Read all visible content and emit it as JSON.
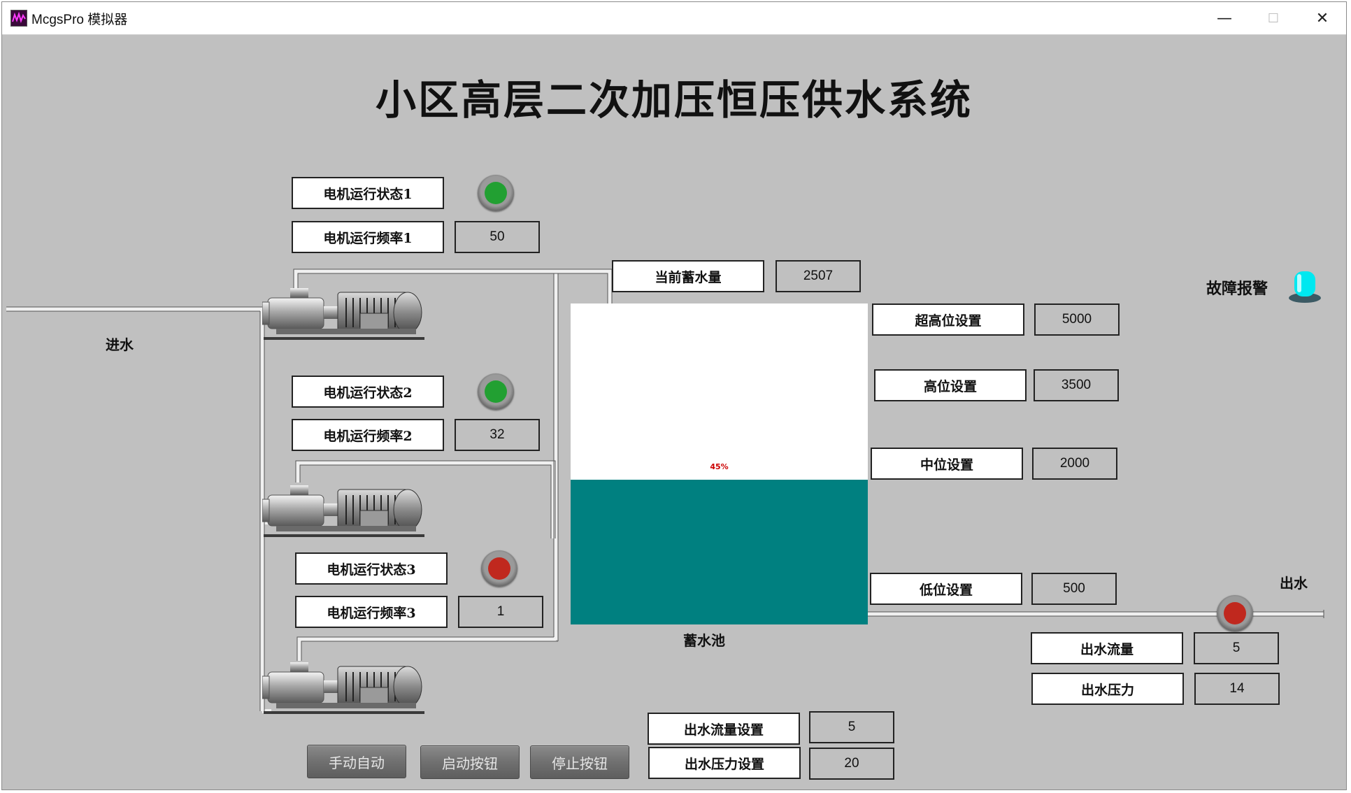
{
  "window": {
    "title": "McgsPro 模拟器",
    "minimize": "—",
    "maximize": "☐",
    "close": "✕"
  },
  "screen": {
    "title": "小区高层二次加压恒压供水系统",
    "motors": [
      {
        "status_label": "电机运行状态1",
        "status": "running",
        "freq_label": "电机运行频率1",
        "freq": "50"
      },
      {
        "status_label": "电机运行状态2",
        "status": "running",
        "freq_label": "电机运行频率2",
        "freq": "32"
      },
      {
        "status_label": "电机运行状态3",
        "status": "stopped",
        "freq_label": "电机运行频率3",
        "freq": "1"
      }
    ],
    "inlet_label": "进水",
    "outlet_label": "出水",
    "storage": {
      "label": "当前蓄水量",
      "value": "2507"
    },
    "tank": {
      "label": "蓄水池",
      "percent_text": "45%",
      "level": 0.45
    },
    "setpoints": {
      "super_high": {
        "label": "超高位设置",
        "value": "5000"
      },
      "high": {
        "label": "高位设置",
        "value": "3500"
      },
      "mid": {
        "label": "中位设置",
        "value": "2000"
      },
      "low": {
        "label": "低位设置",
        "value": "500"
      }
    },
    "fault": {
      "label": "故障报警"
    },
    "outflow": {
      "label": "出水流量",
      "value": "5"
    },
    "outpressure": {
      "label": "出水压力",
      "value": "14"
    },
    "flow_set": {
      "label": "出水流量设置",
      "value": "5"
    },
    "pressure_set": {
      "label": "出水压力设置",
      "value": "20"
    },
    "buttons": {
      "manual_auto": "手动自动",
      "start": "启动按钮",
      "stop": "停止按钮"
    },
    "colors": {
      "background": "#c0c0c0",
      "water": "#008080",
      "lamp_on": "#22a032",
      "lamp_off": "#c0281e",
      "alarm": "#00e8f0"
    }
  }
}
